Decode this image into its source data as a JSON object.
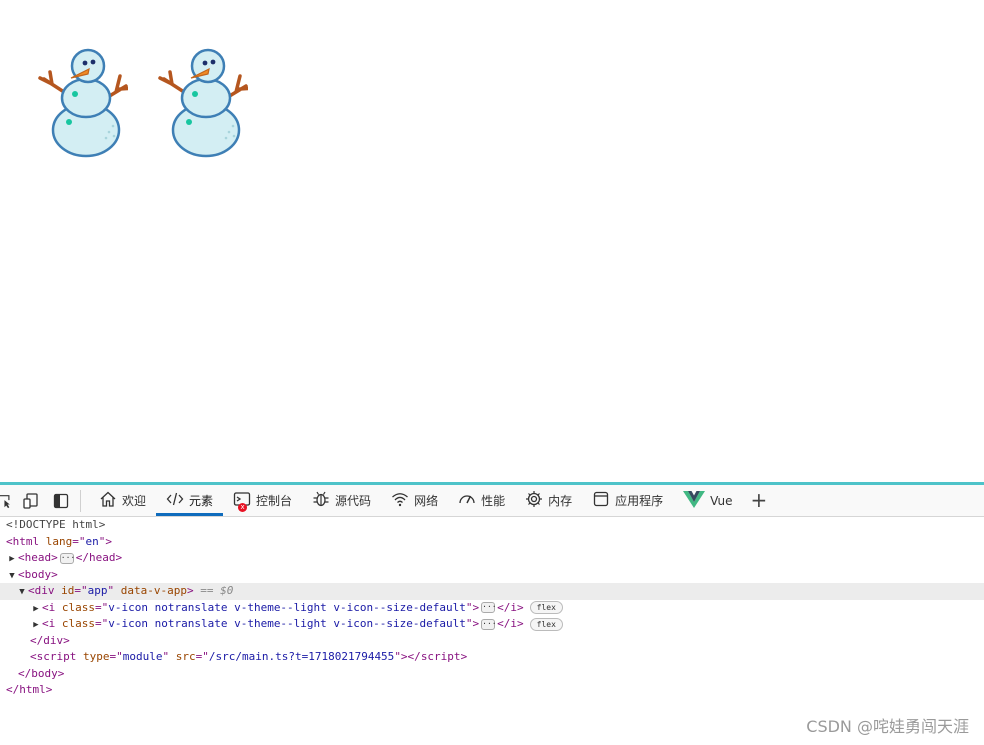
{
  "page": {
    "snowmen": [
      {
        "icon": "snowman-icon"
      },
      {
        "icon": "snowman-icon"
      }
    ]
  },
  "devtools": {
    "accent_color": "#4ec3c9",
    "active_tab_color": "#0f6cbd",
    "tools": [
      {
        "icon": "inspect-icon"
      },
      {
        "icon": "device-emulation-icon"
      },
      {
        "icon": "dock-panel-icon"
      }
    ],
    "tabs": [
      {
        "label": "欢迎",
        "icon": "home-icon"
      },
      {
        "label": "元素",
        "icon": "code-icon",
        "active": true
      },
      {
        "label": "控制台",
        "icon": "console-icon",
        "error_count": "x"
      },
      {
        "label": "源代码",
        "icon": "bug-icon"
      },
      {
        "label": "网络",
        "icon": "wifi-icon"
      },
      {
        "label": "性能",
        "icon": "gauge-icon"
      },
      {
        "label": "内存",
        "icon": "memory-chip-icon"
      },
      {
        "label": "应用程序",
        "icon": "application-icon"
      },
      {
        "label": "Vue",
        "icon": "vue-logo-icon"
      }
    ],
    "add_tab": "+",
    "tree": {
      "doctype": "<!DOCTYPE html>",
      "html_open": "html",
      "html_attr_name": "lang",
      "html_attr_val": "en",
      "head": "head",
      "body": "body",
      "div": "div",
      "div_id_name": "id",
      "div_id_val": "app",
      "div_attr2": "data-v-app",
      "selected_marker": "== $0",
      "i_tag": "i",
      "i_class_name": "class",
      "i_class_val": "v-icon notranslate v-theme--light v-icon--size-default",
      "flex_badge": "flex",
      "script": "script",
      "script_type_name": "type",
      "script_type_val": "module",
      "script_src_name": "src",
      "script_src_val": "/src/main.ts?t=1718021794455",
      "ellipsis": "···"
    }
  },
  "watermark": "CSDN @咤娃勇闯天涯"
}
